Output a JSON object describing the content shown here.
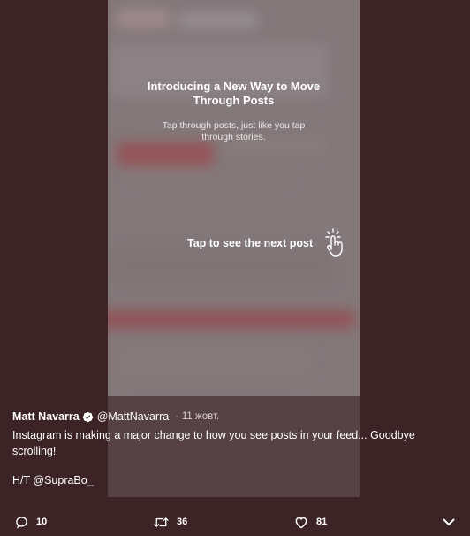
{
  "video": {
    "intro_title": "Introducing a New Way to Move Through Posts",
    "intro_subtitle": "Tap through posts, just like you tap through stories.",
    "tap_hint": "Tap to see the next post"
  },
  "tweet": {
    "author_name": "Matt Navarra",
    "handle": "@MattNavarra",
    "separator": "·",
    "date": "11 жовт.",
    "text": "Instagram is making a major change to how you see posts in your feed... Goodbye scrolling!",
    "credit": "H/T @SupraBo_"
  },
  "actions": {
    "reply_count": "10",
    "retweet_count": "36",
    "like_count": "81"
  },
  "icons": {
    "verified": "verified-badge-icon",
    "tap": "tap-hand-icon",
    "reply": "reply-icon",
    "retweet": "retweet-icon",
    "like": "heart-icon",
    "more": "chevron-down-icon"
  },
  "colors": {
    "background": "#3b2326",
    "text": "#ffffff",
    "muted": "#d9cfd0"
  }
}
